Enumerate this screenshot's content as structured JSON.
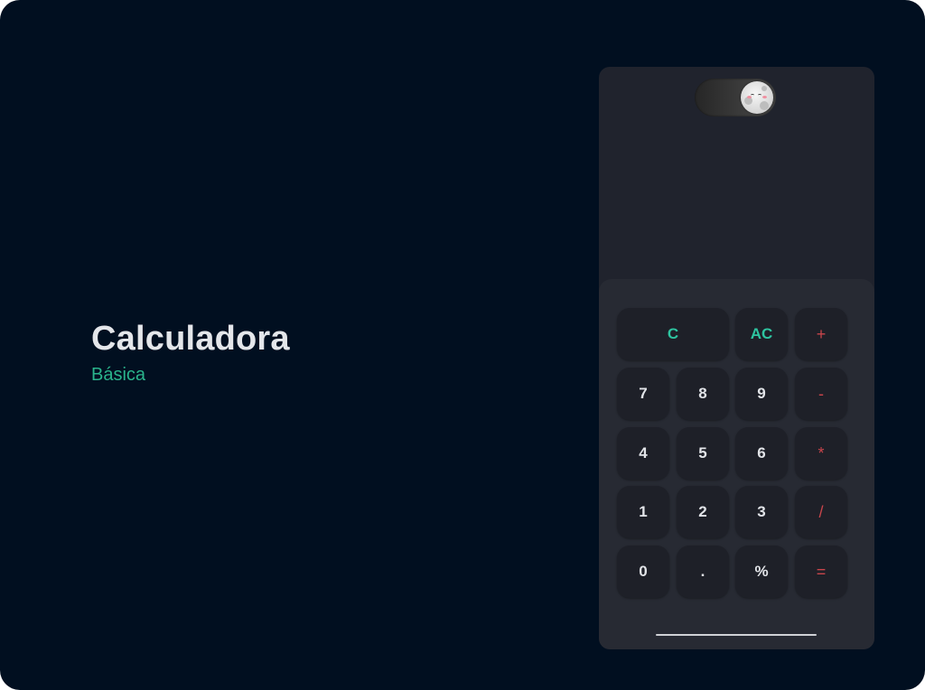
{
  "hero": {
    "title": "Calculadora",
    "subtitle": "Básica"
  },
  "theme_toggle": {
    "state": "dark",
    "knob_icon": "moon-icon"
  },
  "display": {
    "value": ""
  },
  "keys": {
    "clear": "C",
    "all_clear": "AC",
    "plus": "+",
    "seven": "7",
    "eight": "8",
    "nine": "9",
    "minus": "-",
    "four": "4",
    "five": "5",
    "six": "6",
    "multiply": "*",
    "one": "1",
    "two": "2",
    "three": "3",
    "divide": "/",
    "zero": "0",
    "dot": ".",
    "percent": "%",
    "equals": "="
  },
  "colors": {
    "background": "#010f20",
    "panel": "#20232d",
    "keypad": "#272a33",
    "key": "#1e2028",
    "accent_teal": "#2ec4a0",
    "accent_red": "#c8454b",
    "subtitle": "#2ab48c"
  }
}
